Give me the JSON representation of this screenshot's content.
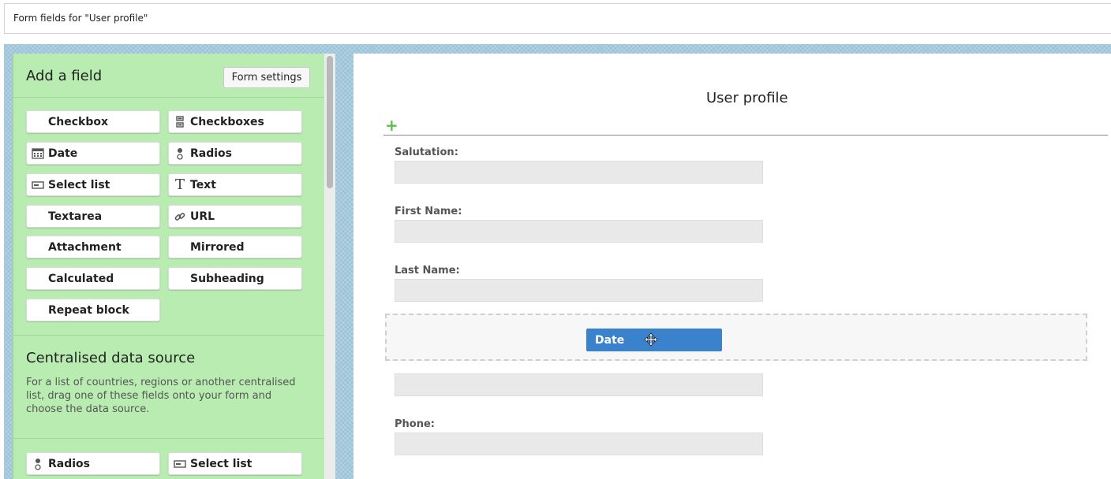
{
  "header": {
    "title": "Form fields for \"User profile\""
  },
  "sidebar": {
    "add_field_title": "Add a field",
    "form_settings_label": "Form settings",
    "fields": [
      {
        "label": "Checkbox",
        "icon": ""
      },
      {
        "label": "Checkboxes",
        "icon": "checkboxes-icon"
      },
      {
        "label": "Date",
        "icon": "calendar-icon"
      },
      {
        "label": "Radios",
        "icon": "radios-icon"
      },
      {
        "label": "Select list",
        "icon": "select-list-icon"
      },
      {
        "label": "Text",
        "icon": "text-icon"
      },
      {
        "label": "Textarea",
        "icon": ""
      },
      {
        "label": "URL",
        "icon": "link-icon"
      },
      {
        "label": "Attachment",
        "icon": ""
      },
      {
        "label": "Mirrored",
        "icon": ""
      },
      {
        "label": "Calculated",
        "icon": ""
      },
      {
        "label": "Subheading",
        "icon": ""
      },
      {
        "label": "Repeat block",
        "icon": ""
      }
    ],
    "cds_title": "Centralised data source",
    "cds_description": "For a list of countries, regions or another centralised list, drag one of these fields onto your form and choose the data source.",
    "cds_fields": [
      {
        "label": "Radios",
        "icon": "radios-icon"
      },
      {
        "label": "Select list",
        "icon": "select-list-icon"
      }
    ]
  },
  "form": {
    "title": "User profile",
    "fields": [
      {
        "label": "Salutation:"
      },
      {
        "label": "First Name:"
      },
      {
        "label": "Last Name:"
      },
      {
        "label": "Phone:"
      }
    ],
    "dragging_label": "Date"
  }
}
